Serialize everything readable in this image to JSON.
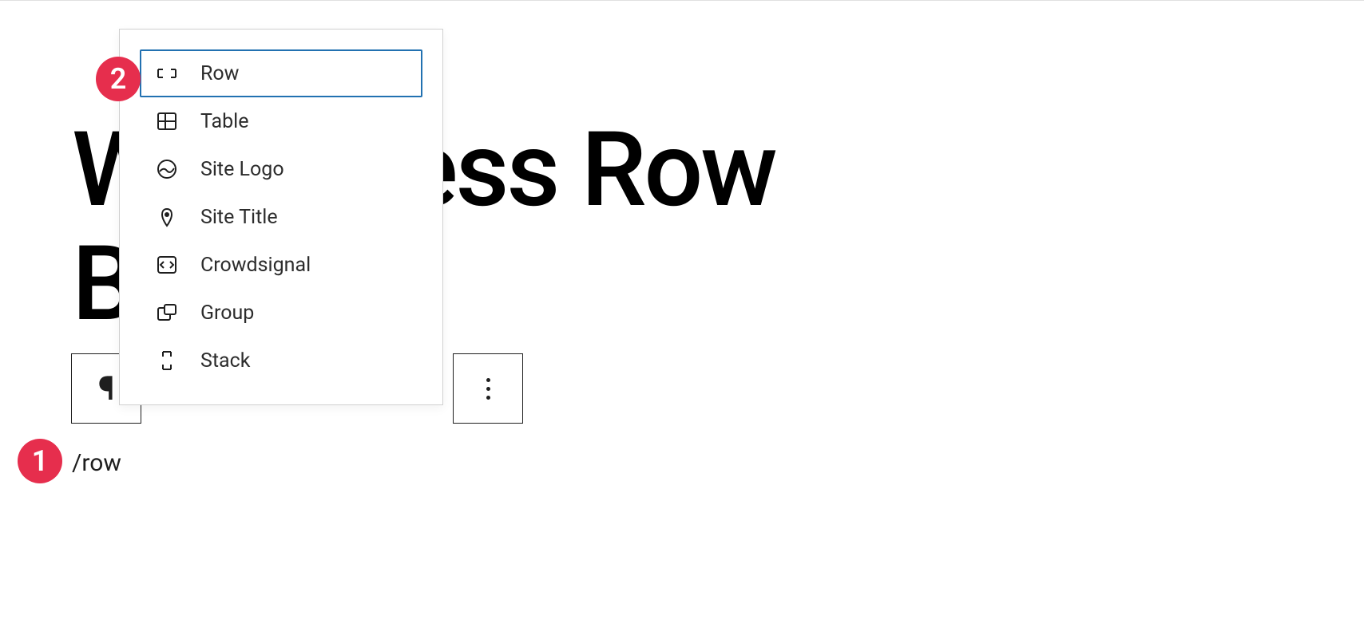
{
  "page": {
    "title_line1": "WordPress Row",
    "title_line2": "Block"
  },
  "slash_command": "/row",
  "popover": {
    "items": [
      {
        "label": "Row",
        "icon": "row-icon",
        "selected": true
      },
      {
        "label": "Table",
        "icon": "table-icon",
        "selected": false
      },
      {
        "label": "Site Logo",
        "icon": "site-logo-icon",
        "selected": false
      },
      {
        "label": "Site Title",
        "icon": "site-title-icon",
        "selected": false
      },
      {
        "label": "Crowdsignal",
        "icon": "crowdsignal-icon",
        "selected": false
      },
      {
        "label": "Group",
        "icon": "group-icon",
        "selected": false
      },
      {
        "label": "Stack",
        "icon": "stack-icon",
        "selected": false
      }
    ]
  },
  "annotations": {
    "one": "1",
    "two": "2"
  }
}
